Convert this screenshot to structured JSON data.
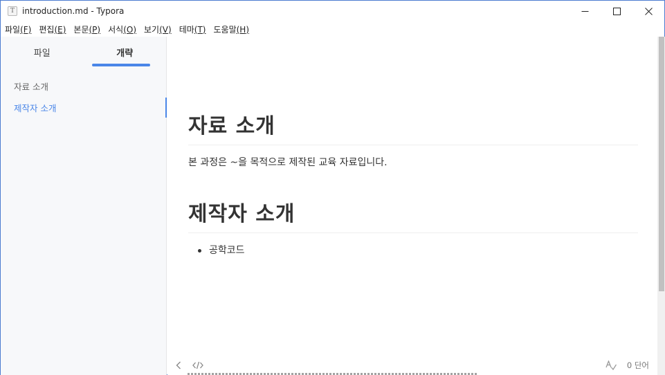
{
  "window": {
    "title": "introduction.md - Typora",
    "app_icon_letter": "T",
    "controls": [
      "minimize-icon",
      "maximize-icon",
      "close-icon"
    ]
  },
  "menu": [
    {
      "label": "파일",
      "key": "(F)"
    },
    {
      "label": "편집",
      "key": "(E)"
    },
    {
      "label": "본문",
      "key": "(P)"
    },
    {
      "label": "서식",
      "key": "(O)"
    },
    {
      "label": "보기",
      "key": "(V)"
    },
    {
      "label": "테마",
      "key": "(T)"
    },
    {
      "label": "도움말",
      "key": "(H)"
    }
  ],
  "sidebar": {
    "tabs": [
      {
        "label": "파일",
        "active": false
      },
      {
        "label": "개략",
        "active": true
      }
    ],
    "outline": [
      {
        "label": "자료 소개",
        "active": false
      },
      {
        "label": "제작자 소개",
        "active": true
      }
    ]
  },
  "document": {
    "heading1": "자료 소개",
    "paragraph": "본 과정은 ~을 목적으로 제작된 교육 자료입니다.",
    "heading2": "제작자 소개",
    "list_items": [
      "공학코드"
    ]
  },
  "statusbar": {
    "word_count": "0 단어",
    "icons": [
      "back-icon",
      "source-code-icon",
      "spellcheck-icon"
    ]
  },
  "colors": {
    "accent": "#4a86e8",
    "sidebar_bg": "#f7f8fa",
    "text": "#333333"
  }
}
